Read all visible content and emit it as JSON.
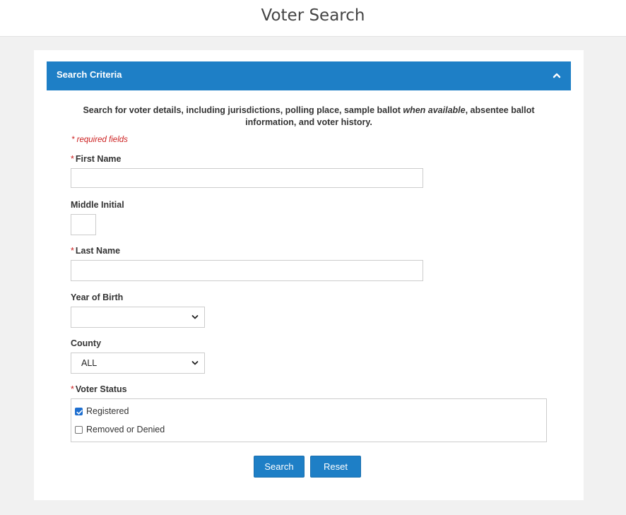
{
  "header": {
    "title": "Voter Search"
  },
  "panel": {
    "title": "Search Criteria",
    "collapse_icon": "chevron-up-icon",
    "header_color": "#1e7fc6"
  },
  "intro": {
    "part1": "Search for voter details, including jurisdictions, polling place, sample ballot ",
    "emphasis": "when available",
    "part2": ", absentee ballot information, and voter history."
  },
  "required_note": "* required fields",
  "fields": {
    "first_name": {
      "label": "First Name",
      "required": true,
      "value": ""
    },
    "middle_initial": {
      "label": "Middle Initial",
      "required": false,
      "value": ""
    },
    "last_name": {
      "label": "Last Name",
      "required": true,
      "value": ""
    },
    "year_of_birth": {
      "label": "Year of Birth",
      "required": false,
      "selected": ""
    },
    "county": {
      "label": "County",
      "required": false,
      "selected": "ALL"
    },
    "voter_status": {
      "label": "Voter Status",
      "required": true,
      "options": [
        {
          "label": "Registered",
          "checked": true
        },
        {
          "label": "Removed or Denied",
          "checked": false
        }
      ]
    }
  },
  "buttons": {
    "search": "Search",
    "reset": "Reset"
  },
  "required_star": "*"
}
